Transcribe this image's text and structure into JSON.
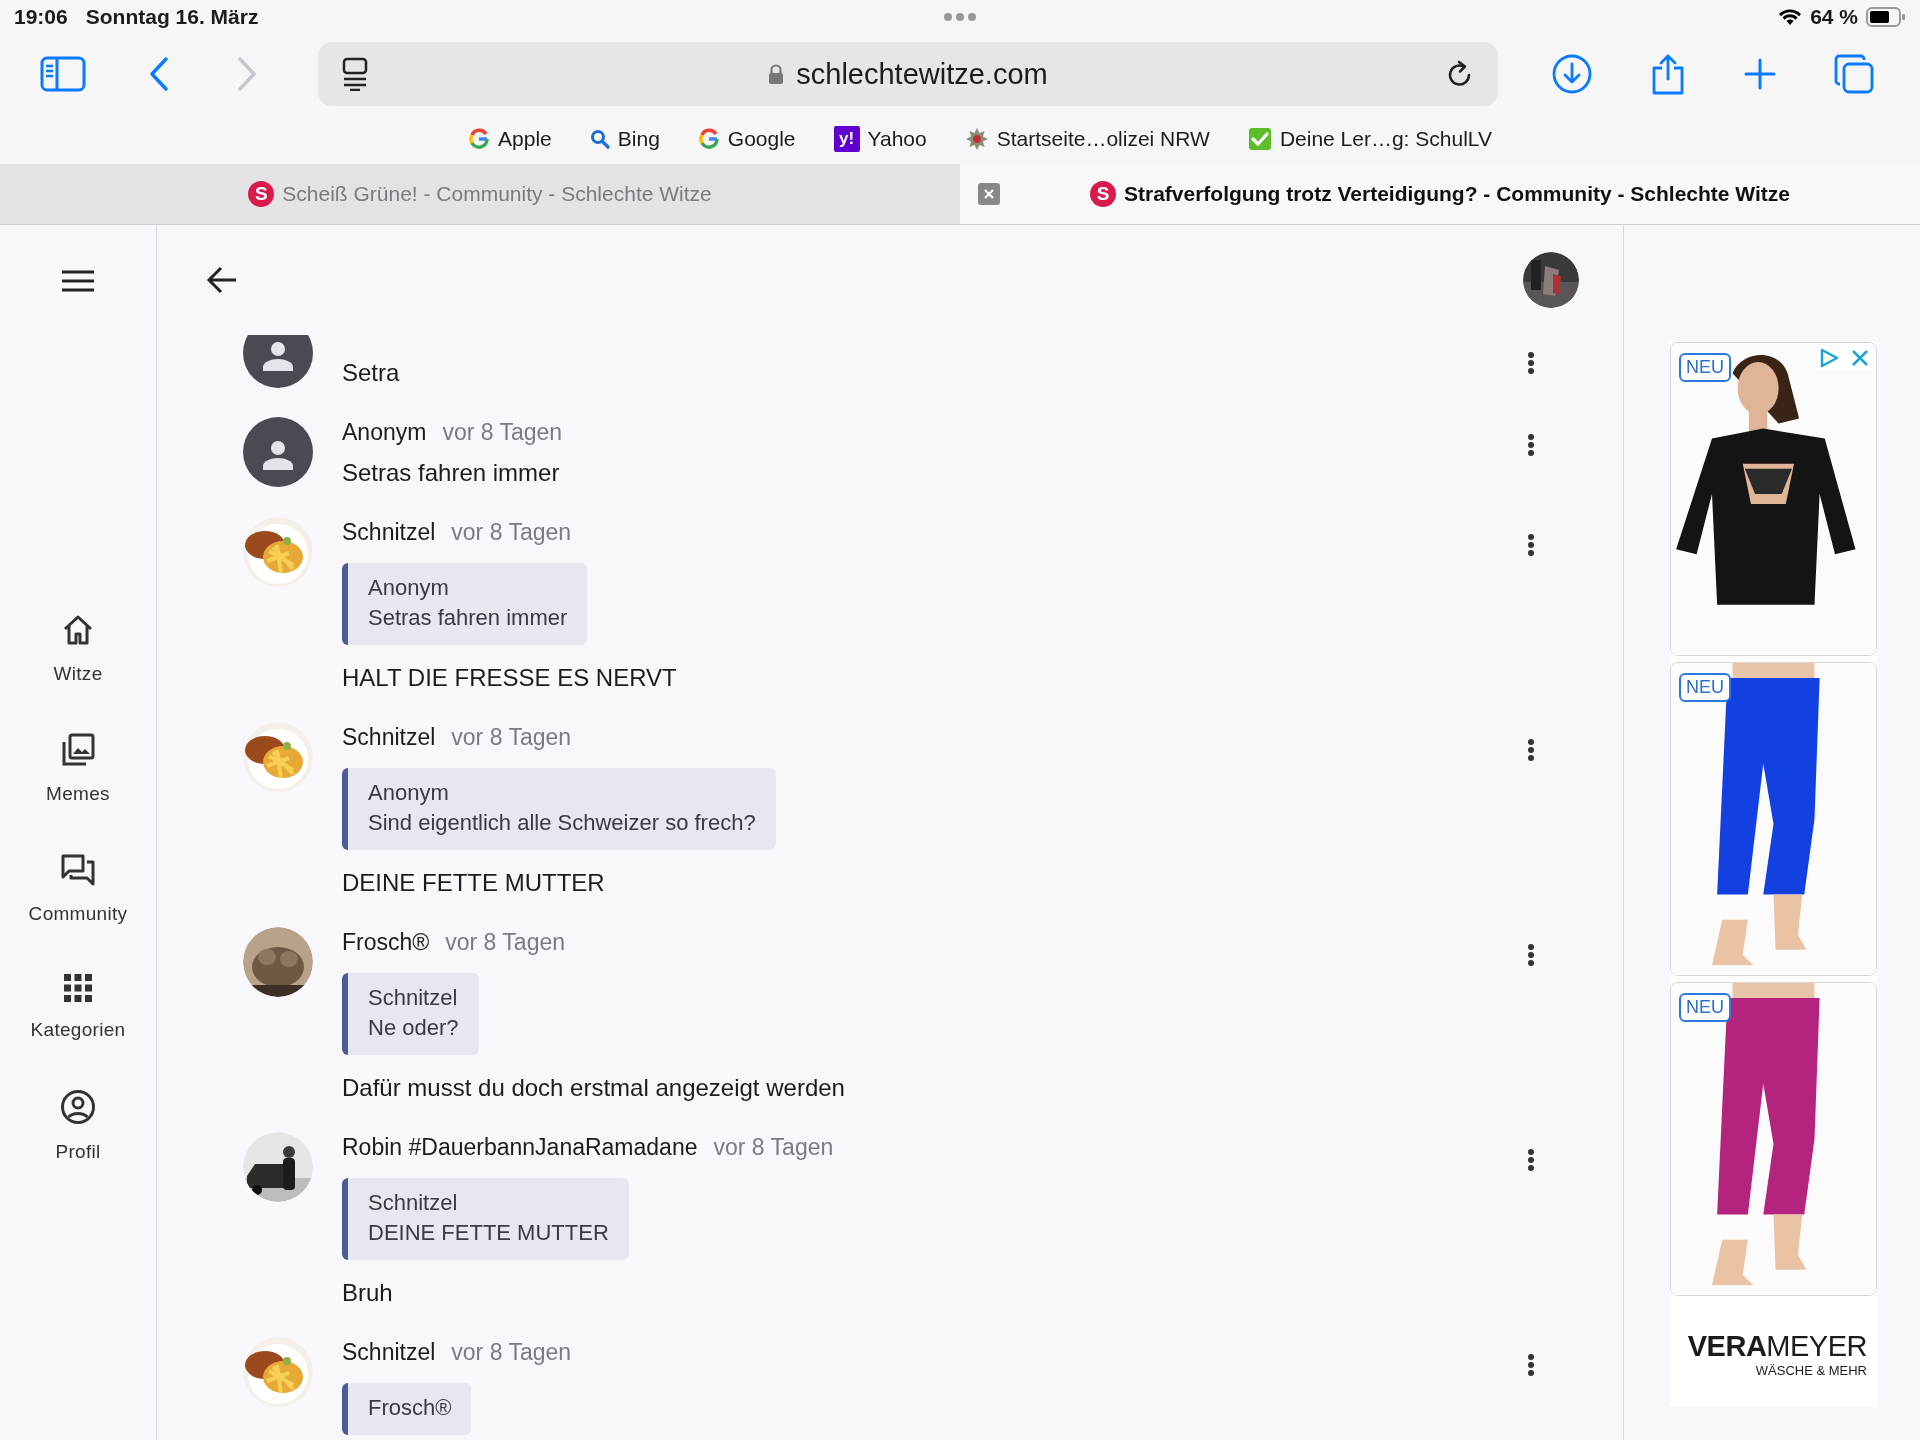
{
  "status_bar": {
    "time": "19:06",
    "date": "Sonntag 16. März",
    "battery": "64 %"
  },
  "toolbar": {
    "url": "schlechtewitze.com",
    "nav": [
      {
        "kind": "back",
        "disabled": false
      },
      {
        "kind": "forward",
        "disabled": true
      }
    ]
  },
  "favorites": [
    {
      "label": "Apple",
      "kind": "google"
    },
    {
      "label": "Bing",
      "kind": "search"
    },
    {
      "label": "Google",
      "kind": "google"
    },
    {
      "label": "Yahoo",
      "kind": "yahoo",
      "icon_text": "y!"
    },
    {
      "label": "Startseite…olizei NRW",
      "kind": "emblem"
    },
    {
      "label": "Deine Ler…g: SchulLV",
      "kind": "check"
    }
  ],
  "tabs": [
    {
      "title": "Scheiß Grüne! - Community - Schlechte Witze",
      "favicon": "S",
      "selected": false
    },
    {
      "title": "Strafverfolgung trotz Verteidigung? - Community - Schlechte Witze",
      "favicon": "S",
      "selected": true
    }
  ],
  "sidebar": {
    "items": [
      {
        "label": "Witze",
        "kind": "home"
      },
      {
        "label": "Memes",
        "kind": "images"
      },
      {
        "label": "Community",
        "kind": "forum"
      },
      {
        "label": "Kategorien",
        "kind": "grid"
      },
      {
        "label": "Profil",
        "kind": "account"
      }
    ]
  },
  "comments": [
    {
      "kind": "anonymous",
      "text": "Setra"
    },
    {
      "author": "Anonym",
      "time": "vor 8 Tagen",
      "kind": "anonymous",
      "text": "Setras fahren immer"
    },
    {
      "author": "Schnitzel",
      "time": "vor 8 Tagen",
      "kind": "picture",
      "quote": {
        "author": "Anonym",
        "text": "Setras fahren immer"
      },
      "text": "HALT DIE FRESSE ES NERVT"
    },
    {
      "author": "Schnitzel",
      "time": "vor 8 Tagen",
      "kind": "picture",
      "quote": {
        "author": "Anonym",
        "text": "Sind eigentlich alle Schweizer so frech?"
      },
      "text": "DEINE FETTE MUTTER"
    },
    {
      "author": "Frosch®",
      "time": "vor 8 Tagen",
      "kind": "picture",
      "quote": {
        "author": "Schnitzel",
        "text": "Ne oder?"
      },
      "text": "Dafür musst du doch erstmal angezeigt werden"
    },
    {
      "author": "Robin #DauerbannJanaRamadane",
      "time": "vor 8 Tagen",
      "kind": "picture",
      "quote": {
        "author": "Schnitzel",
        "text": "DEINE FETTE MUTTER"
      },
      "text": "Bruh"
    },
    {
      "author": "Schnitzel",
      "time": "vor 8 Tagen",
      "kind": "picture",
      "quote": {
        "author": "Frosch®"
      }
    }
  ],
  "ad": {
    "panels": [
      {
        "badge": "NEU",
        "kind": "picture"
      },
      {
        "badge": "NEU",
        "kind": "picture"
      },
      {
        "badge": "NEU",
        "kind": "picture"
      }
    ],
    "logo": "**VERA**MEYER",
    "tagline": "WÄSCHE & MEHR"
  }
}
